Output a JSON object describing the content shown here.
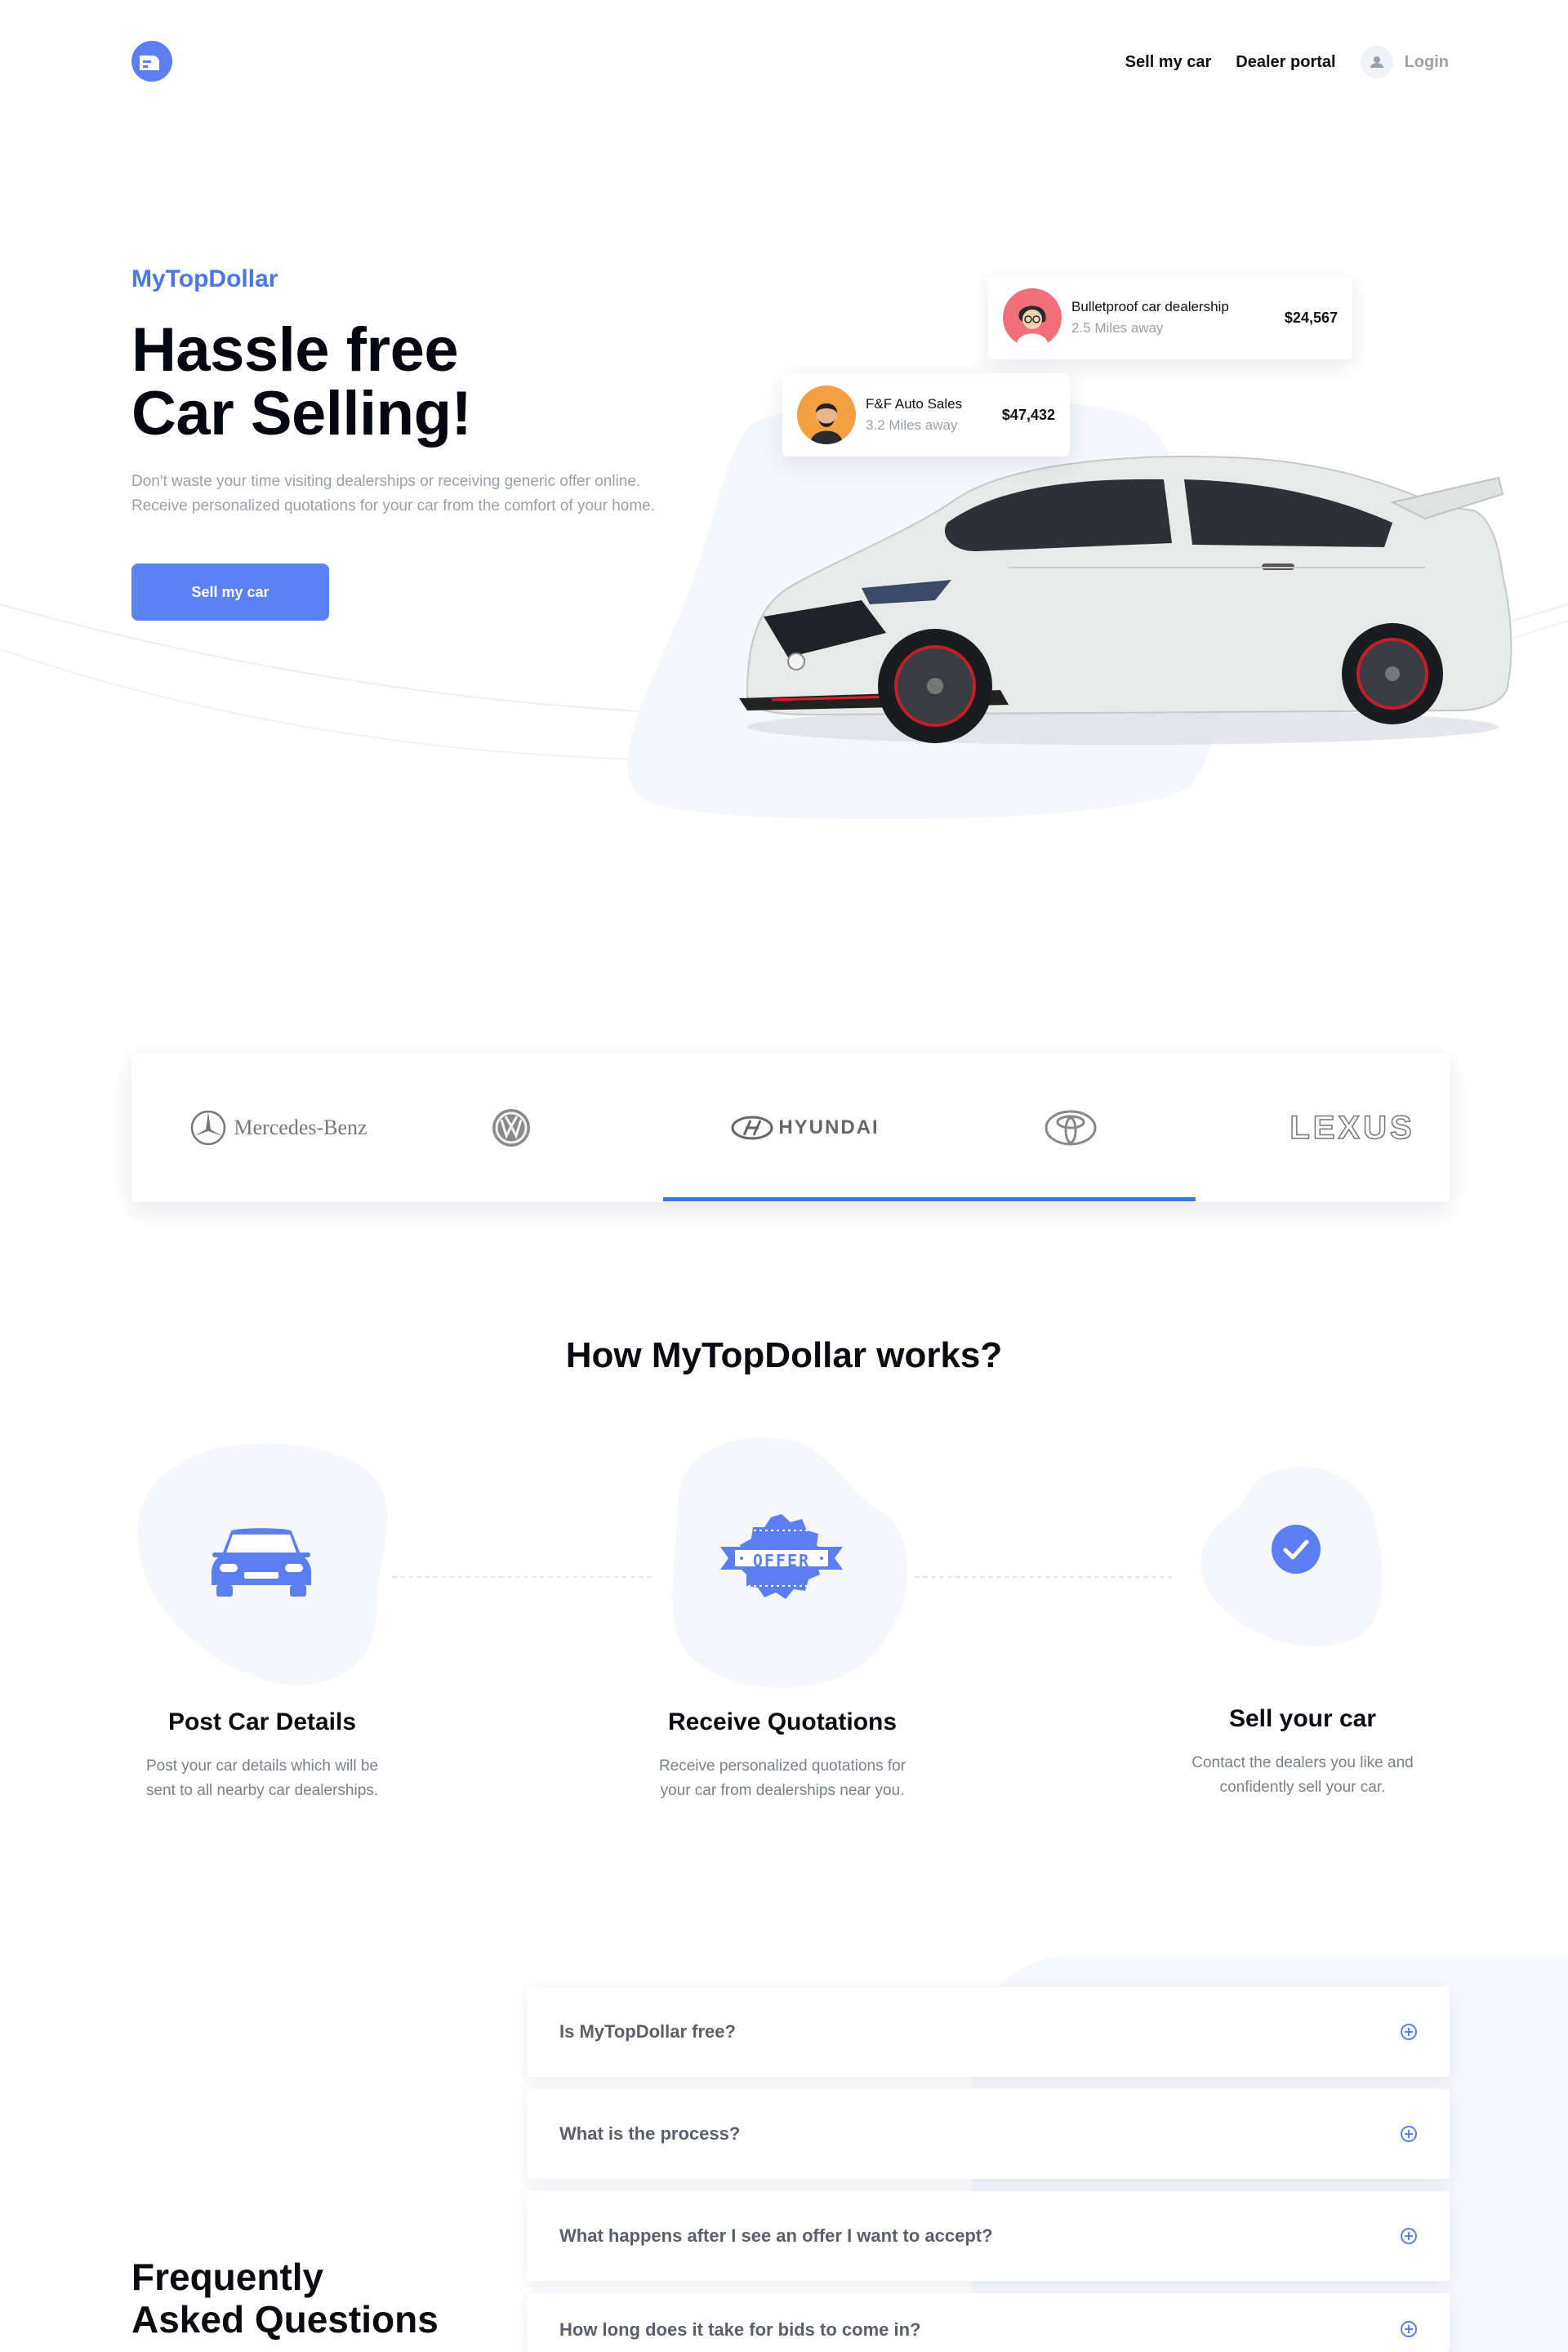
{
  "nav": {
    "links": [
      "Sell my car",
      "Dealer portal"
    ],
    "login_label": "Login"
  },
  "hero": {
    "brand": "MyTopDollar",
    "title_line1": "Hassle free",
    "title_line2": "Car Selling!",
    "description": "Don't waste your time visiting dealerships or receiving generic offer online. Receive personalized quotations for your car from the comfort of your home.",
    "cta_label": "Sell my car",
    "offers": [
      {
        "dealer": "Bulletproof car dealership",
        "distance": "2.5 Miles away",
        "price": "$24,567"
      },
      {
        "dealer": "F&F Auto Sales",
        "distance": "3.2 Miles away",
        "price": "$47,432"
      }
    ]
  },
  "brands": {
    "items": [
      "Mercedes-Benz",
      "Volkswagen",
      "HYUNDAI",
      "Toyota",
      "LEXUS"
    ],
    "active_index": 2
  },
  "how": {
    "title": "How MyTopDollar works?",
    "badge_text": "OFFER",
    "steps": [
      {
        "title": "Post Car Details",
        "desc_line1": "Post your car details which will be",
        "desc_line2": "sent to all nearby car dealerships."
      },
      {
        "title": "Receive Quotations",
        "desc_line1": "Receive personalized quotations for",
        "desc_line2": "your car from dealerships near you."
      },
      {
        "title": "Sell your car",
        "desc_line1": "Contact the dealers you like and",
        "desc_line2": "confidently sell your car."
      }
    ]
  },
  "faq": {
    "title_line1": "Frequently",
    "title_line2": "Asked Questions",
    "items": [
      "Is MyTopDollar free?",
      "What is the process?",
      "What happens after I see an offer I want to accept?",
      "How long does it take for bids to come in?"
    ]
  },
  "colors": {
    "accent": "#5b82f3",
    "brand_text": "#4b77e6",
    "underline": "#3d72e8",
    "icon_blue": "#5b7ff0"
  }
}
